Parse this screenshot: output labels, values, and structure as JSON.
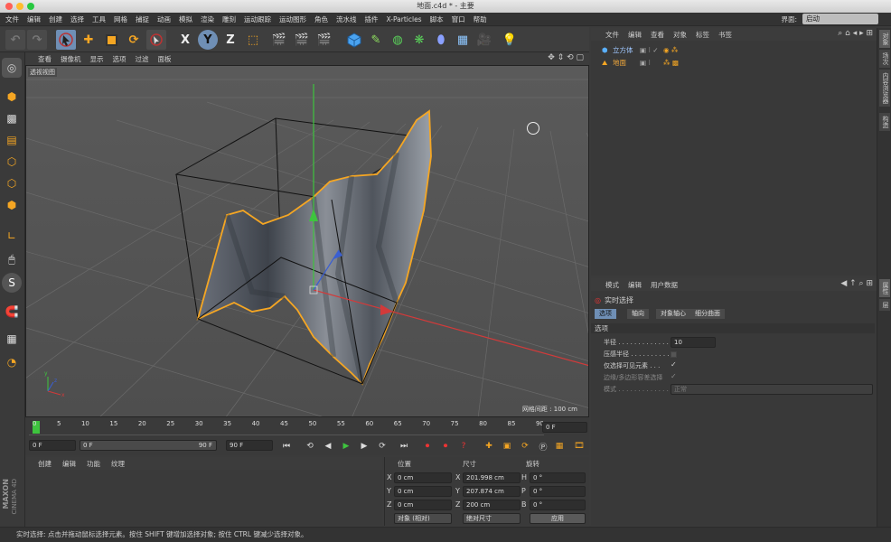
{
  "window": {
    "title": "地面.c4d * - 主要"
  },
  "menubar": {
    "items": [
      "文件",
      "编辑",
      "创建",
      "选择",
      "工具",
      "网格",
      "捕捉",
      "动画",
      "模拟",
      "渲染",
      "雕刻",
      "运动跟踪",
      "运动图形",
      "角色",
      "流水线",
      "插件",
      "X-Particles",
      "脚本",
      "窗口",
      "帮助"
    ],
    "layout_label": "界面:",
    "layout_value": "启动"
  },
  "toolbar": {
    "axis_x": "X",
    "axis_y": "Y",
    "axis_z": "Z"
  },
  "viewport": {
    "menu": [
      "查看",
      "摄像机",
      "显示",
      "选项",
      "过滤",
      "面板"
    ],
    "view_name": "透视视图",
    "grid_spacing": "网格间距 : 100 cm"
  },
  "timeline": {
    "ticks": [
      "0",
      "5",
      "10",
      "15",
      "20",
      "25",
      "30",
      "35",
      "40",
      "45",
      "50",
      "55",
      "60",
      "65",
      "70",
      "75",
      "80",
      "85",
      "90"
    ],
    "current_frame": "0 F"
  },
  "transport": {
    "start": "0 F",
    "range_start": "0 F",
    "range_end": "90 F",
    "end": "90 F"
  },
  "material": {
    "menu": [
      "创建",
      "编辑",
      "功能",
      "纹理"
    ]
  },
  "coords": {
    "headers": [
      "位置",
      "尺寸",
      "旋转"
    ],
    "rows": [
      {
        "axis": "X",
        "pos": "0 cm",
        "size_axis": "X",
        "size": "201.998 cm",
        "rot_axis": "H",
        "rot": "0 °"
      },
      {
        "axis": "Y",
        "pos": "0 cm",
        "size_axis": "Y",
        "size": "207.874 cm",
        "rot_axis": "P",
        "rot": "0 °"
      },
      {
        "axis": "Z",
        "pos": "0 cm",
        "size_axis": "Z",
        "size": "200 cm",
        "rot_axis": "B",
        "rot": "0 °"
      }
    ],
    "mode": "对象 (相对)",
    "size_mode": "绝对尺寸",
    "apply": "应用"
  },
  "object_manager": {
    "menu": [
      "文件",
      "编辑",
      "查看",
      "对象",
      "标签",
      "书签"
    ],
    "objects": [
      {
        "name": "立方体",
        "color": "#9fc7ff"
      },
      {
        "name": "地面",
        "color": "#f3a93b"
      }
    ]
  },
  "attributes": {
    "menu": [
      "模式",
      "编辑",
      "用户数据"
    ],
    "tool": "实时选择",
    "tabs": [
      "选项",
      "轴向",
      "对象轴心",
      "细分曲面"
    ],
    "section": "选项",
    "props": [
      {
        "label": "半径 . . . . . . . . . . . . .",
        "value": "10"
      },
      {
        "label": "压感半径 . . . . . . . . . .",
        "value": ""
      },
      {
        "label": "仅选择可见元素 . . .",
        "value": "✓"
      },
      {
        "label": "边缘/多边形容差选择",
        "value": "✓"
      },
      {
        "label": "模式 . . . . . . . . . . . . .",
        "value": "正常"
      }
    ]
  },
  "right_tabs": [
    "对象",
    "场次",
    "内容浏览器",
    "构造",
    "属性",
    "层"
  ],
  "status": "实时选择: 点击并拖动鼠标选择元素。按住 SHIFT 键增加选择对象; 按住 CTRL 键减少选择对象。",
  "brand": {
    "line1": "MAXON",
    "line2": "CINEMA 4D"
  },
  "colors": {
    "accent": "#f5a623",
    "selection": "#6f8fb5",
    "x_axis": "#d23a3a",
    "y_axis": "#3ec43e",
    "z_axis": "#3a5fd2"
  }
}
